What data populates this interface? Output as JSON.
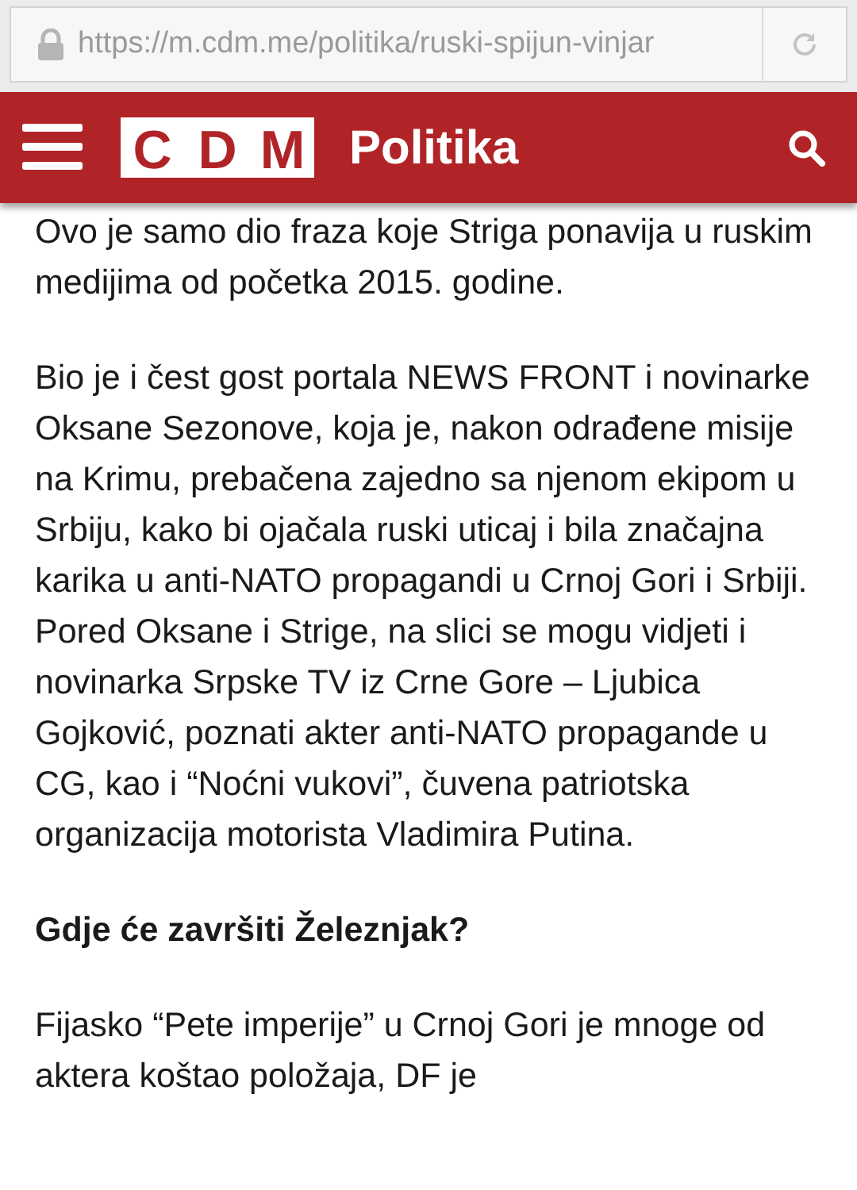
{
  "address_bar": {
    "url": "https://m.cdm.me/politika/ruski-spijun-vinjar"
  },
  "header": {
    "logo_letters": [
      "C",
      "D",
      "M"
    ],
    "section": "Politika"
  },
  "article": [
    {
      "kind": "paragraph",
      "text": "Ovo je samo dio fraza koje Striga ponavija u ruskim medijima od početka 2015. godine."
    },
    {
      "kind": "paragraph",
      "text": "Bio je i čest gost portala NEWS FRONT i novinarke Oksane Sezonove, koja je, nakon odrađene misije na Krimu, prebačena zajedno sa njenom ekipom u Srbiju, kako bi ojačala ruski uticaj i bila značajna karika u anti-NATO propagandi u Crnoj Gori i Srbiji. Pored Oksane i Strige, na slici se mogu vidjeti i novinarka Srpske TV iz Crne Gore – Ljubica Gojković, poznati akter anti-NATO propagande u CG, kao i “Noćni vukovi”, čuvena patriotska organizacija motorista Vladimira Putina."
    },
    {
      "kind": "heading",
      "text": "Gdje će završiti Železnjak?"
    },
    {
      "kind": "paragraph",
      "text": "Fijasko “Pete imperije” u Crnoj Gori je mnoge od aktera koštao položaja, DF je"
    }
  ]
}
